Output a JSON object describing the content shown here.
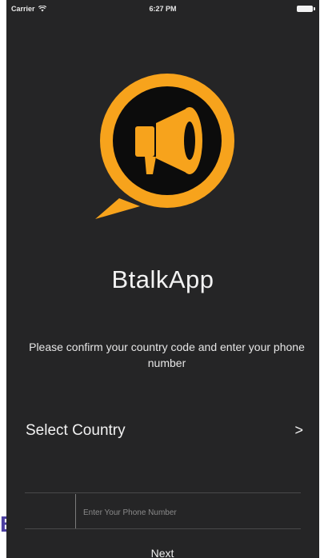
{
  "status_bar": {
    "carrier": "Carrier",
    "time": "6:27 PM"
  },
  "app": {
    "name": "BtalkApp",
    "brand_color": "#f7a31c",
    "background": "#252526"
  },
  "instructions": "Please confirm your country code and enter your phone number",
  "country_selector": {
    "label": "Select Country",
    "chevron": ">"
  },
  "phone_field": {
    "placeholder": "Enter Your Phone Number",
    "value": ""
  },
  "next_label": "Next",
  "edge_fragment": "B",
  "icons": [
    "wifi-icon",
    "battery-icon",
    "megaphone-logo-icon",
    "chevron-right-icon"
  ]
}
